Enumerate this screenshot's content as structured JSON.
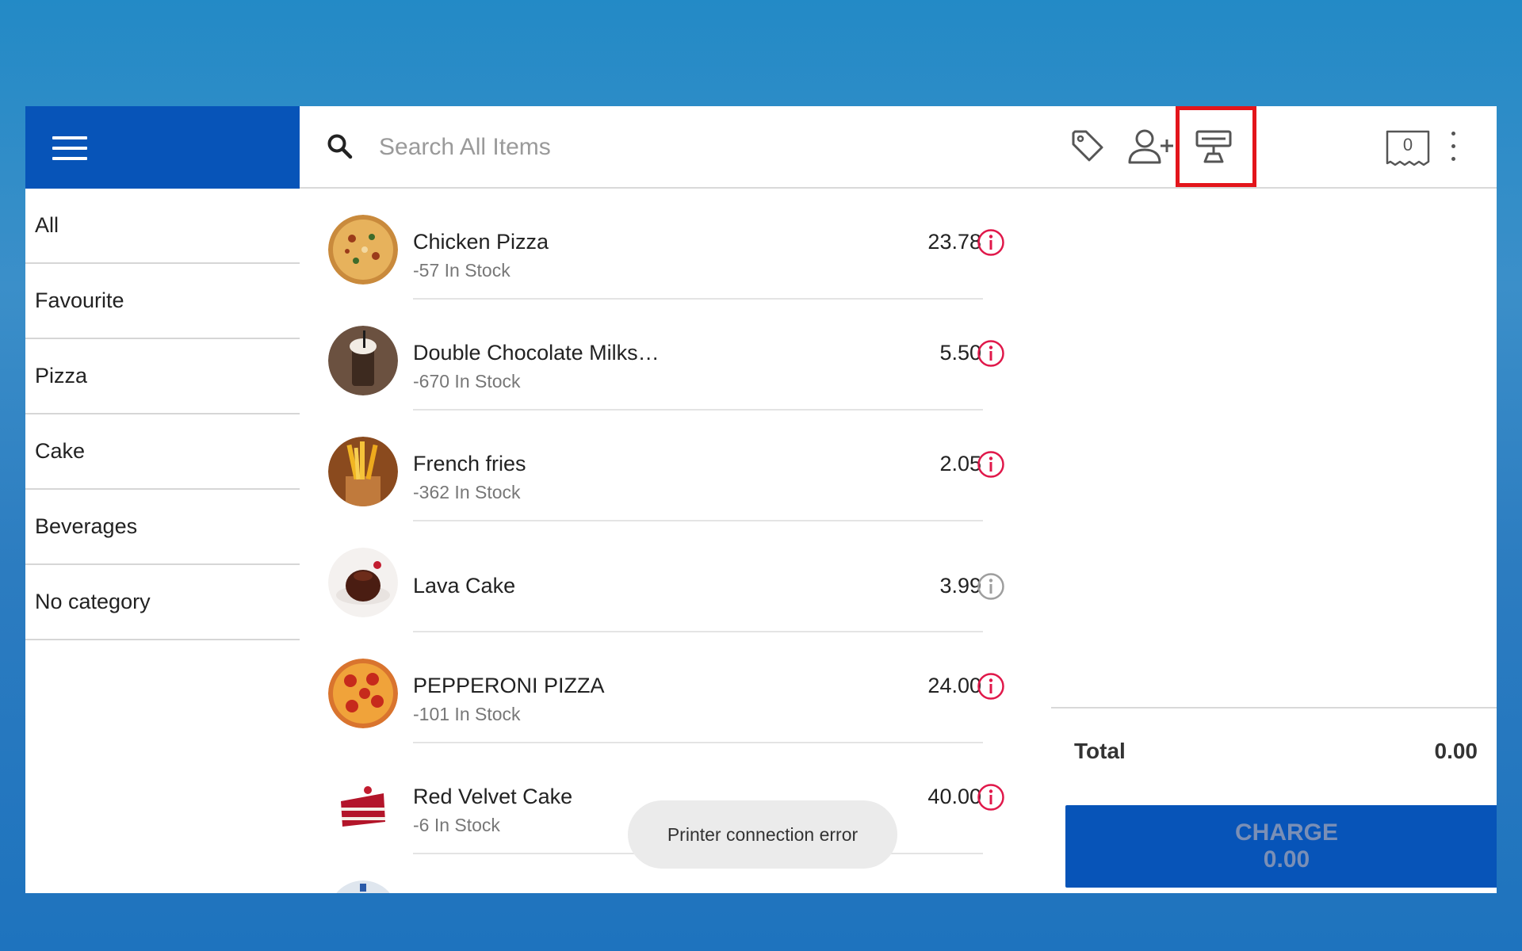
{
  "search": {
    "placeholder": "Search All Items"
  },
  "categories": [
    "All",
    "Favourite",
    "Pizza",
    "Cake",
    "Beverages",
    "No category"
  ],
  "items": [
    {
      "name": "Chicken Pizza",
      "stock": "-57 In Stock",
      "price": "23.78",
      "info_color": "#e0184a"
    },
    {
      "name": "Double Chocolate Milks…",
      "stock": "-670 In Stock",
      "price": "5.50",
      "info_color": "#e0184a"
    },
    {
      "name": "French fries",
      "stock": "-362 In Stock",
      "price": "2.05",
      "info_color": "#e0184a"
    },
    {
      "name": "Lava Cake",
      "stock": "",
      "price": "3.99",
      "info_color": "#9e9e9e"
    },
    {
      "name": "PEPPERONI PIZZA",
      "stock": "-101 In Stock",
      "price": "24.00",
      "info_color": "#e0184a"
    },
    {
      "name": "Red Velvet Cake",
      "stock": "-6 In Stock",
      "price": "40.00",
      "info_color": "#e0184a"
    }
  ],
  "toolbar": {
    "icons": [
      "tag-icon",
      "add-customer-icon",
      "printer-icon",
      "receipt-icon",
      "more-vert-icon"
    ],
    "receipt_count": "0"
  },
  "ticket": {
    "total_label": "Total",
    "total_value": "0.00",
    "charge_label": "CHARGE",
    "charge_amount": "0.00"
  },
  "toast": "Printer connection error",
  "colors": {
    "brand_blue": "#0754b8",
    "highlight_red": "#e3151b"
  }
}
